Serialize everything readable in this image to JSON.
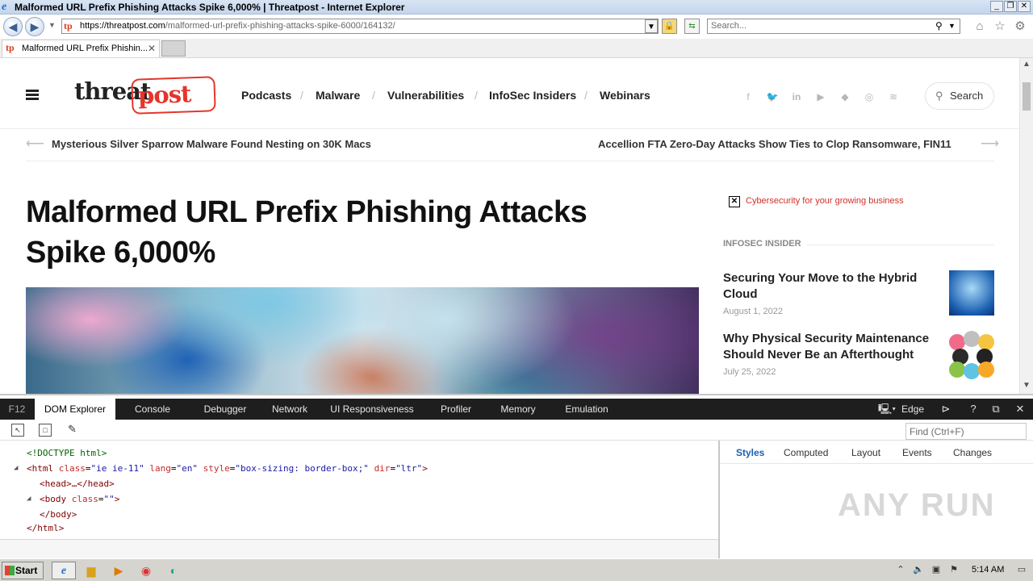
{
  "window": {
    "title": "Malformed URL Prefix Phishing Attacks Spike 6,000% | Threatpost - Internet Explorer"
  },
  "address": {
    "url_host": "https://threatpost.com",
    "url_path": "/malformed-url-prefix-phishing-attacks-spike-6000/164132/",
    "search_placeholder": "Search..."
  },
  "tabs": [
    {
      "label": "Malformed URL Prefix Phishin...",
      "favicon": "tp"
    }
  ],
  "site": {
    "logo_left": "threat",
    "logo_right": "post",
    "nav": [
      "Podcasts",
      "Malware",
      "Vulnerabilities",
      "InfoSec Insiders",
      "Webinars"
    ],
    "nav_sep": "/",
    "social_icons": [
      "facebook-icon",
      "twitter-icon",
      "linkedin-icon",
      "youtube-icon",
      "feedly-icon",
      "instagram-icon",
      "rss-icon"
    ],
    "search_label": "Search",
    "prev_article": "Mysterious Silver Sparrow Malware Found Nesting on 30K Macs",
    "next_article": "Accellion FTA Zero-Day Attacks Show Ties to Clop Ransomware, FIN11",
    "headline": "Malformed URL Prefix Phishing Attacks Spike 6,000%",
    "ad_text": "Cybersecurity for your growing business",
    "insider_header": "INFOSEC INSIDER",
    "insider_cards": [
      {
        "title": "Securing Your Move to the Hybrid Cloud",
        "date": "August 1, 2022"
      },
      {
        "title": "Why Physical Security Maintenance Should Never Be an Afterthought",
        "date": "July 25, 2022"
      }
    ],
    "accent_color": "#e5352b"
  },
  "devtools": {
    "f12": "F12",
    "tabs": [
      "DOM Explorer",
      "Console",
      "Debugger",
      "Network",
      "UI Responsiveness",
      "Profiler",
      "Memory",
      "Emulation"
    ],
    "active_tab": "DOM Explorer",
    "emulation_mode": "Edge",
    "find_placeholder": "Find (Ctrl+F)",
    "style_tabs": [
      "Styles",
      "Computed",
      "Layout",
      "Events",
      "Changes"
    ],
    "dom": {
      "doctype": "<!DOCTYPE html>",
      "html_tag": "html",
      "html_attrs": [
        {
          "name": "class",
          "value": "\"ie ie-11\""
        },
        {
          "name": "lang",
          "value": "\"en\""
        },
        {
          "name": "style",
          "value": "\"box-sizing: border-box;\""
        },
        {
          "name": "dir",
          "value": "\"ltr\""
        }
      ],
      "head_line": "<head>…</head>",
      "body_tag": "body",
      "body_attr_name": "class",
      "body_attr_value": "\"\"",
      "body_close": "</body>",
      "html_close": "</html>"
    },
    "watermark": "ANY RUN"
  },
  "taskbar": {
    "start_label": "Start",
    "clock": "5:14 AM"
  }
}
